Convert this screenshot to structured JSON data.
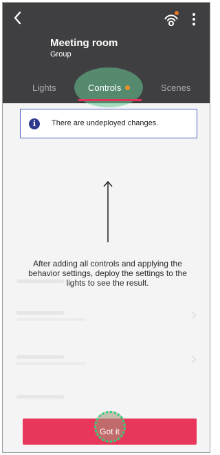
{
  "header": {
    "title": "Meeting room",
    "subtitle": "Group",
    "icons": [
      "back-arrow-icon",
      "network-icon",
      "more-vertical-icon"
    ]
  },
  "tabs": [
    {
      "label": "Lights",
      "active": false
    },
    {
      "label": "Controls",
      "active": true,
      "badge": "orange-dot"
    },
    {
      "label": "Scenes",
      "active": false
    }
  ],
  "banner": {
    "icon": "info-icon",
    "text": "There are undeployed changes."
  },
  "hint": {
    "text": "After adding all controls and applying the behavior settings, deploy the settings to the lights to see the result."
  },
  "cta": {
    "label": "Got it"
  },
  "colors": {
    "header_bg": "#3f3f41",
    "accent": "#e8375b",
    "badge": "#e8922a",
    "info": "#2f3a8f"
  }
}
